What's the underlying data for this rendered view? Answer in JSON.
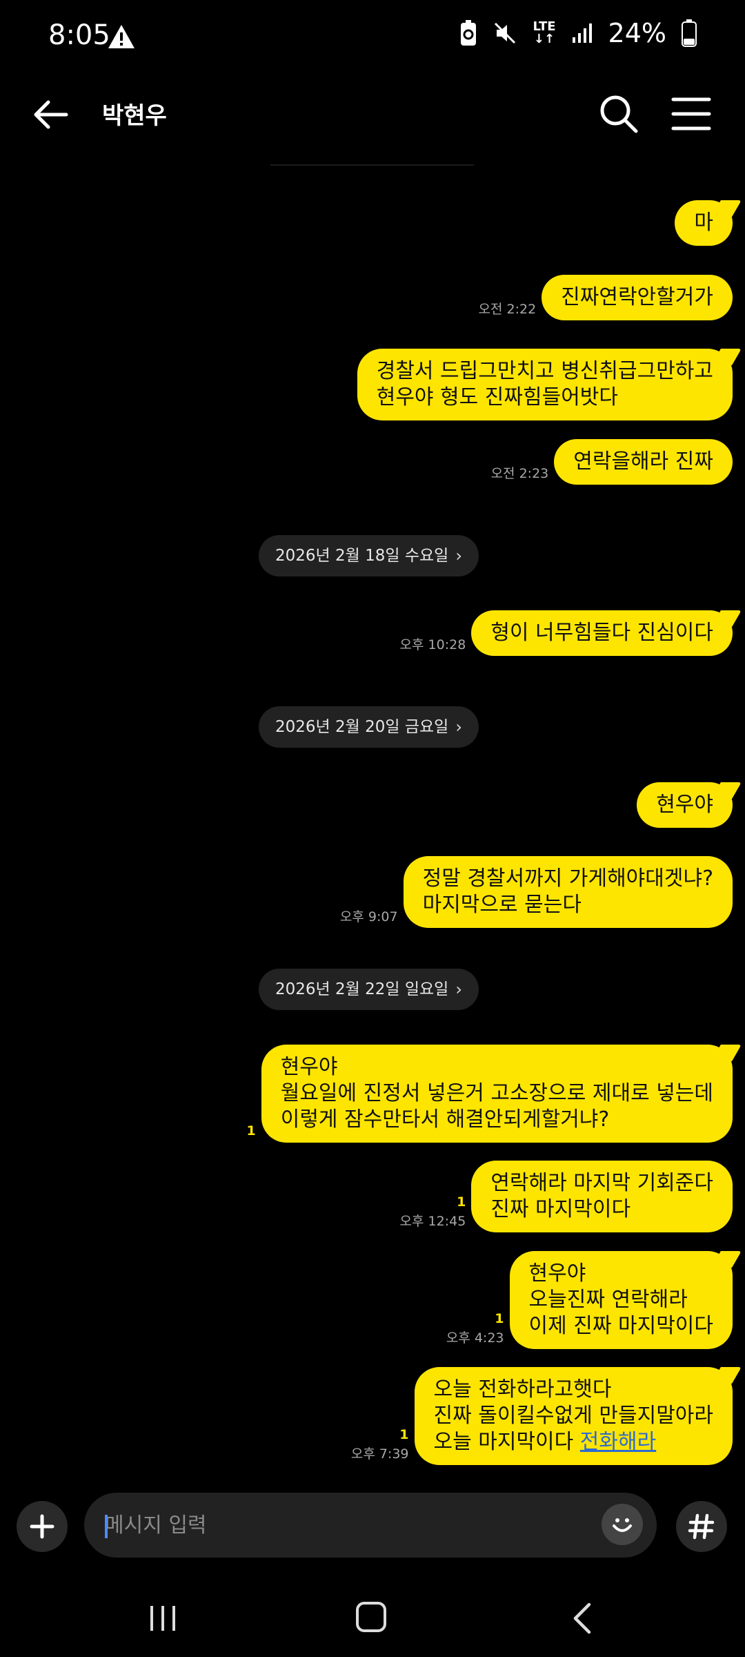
{
  "status_bar": {
    "time": "8:05",
    "network": "LTE",
    "battery": "24%"
  },
  "header": {
    "title": "박현우"
  },
  "date_pills": [
    {
      "label": "2026년 2월 18일 수요일"
    },
    {
      "label": "2026년 2월 20일 금요일"
    },
    {
      "label": "2026년 2월 22일 일요일"
    }
  ],
  "messages": [
    {
      "text": "마",
      "time": "",
      "unread": ""
    },
    {
      "text": "진짜연락안할거가",
      "time": "오전 2:22",
      "unread": ""
    },
    {
      "text": "경찰서 드립그만치고 병신취급그만하고\n현우야 형도 진짜힘들어밧다",
      "time": "",
      "unread": ""
    },
    {
      "text": "연락을해라 진짜",
      "time": "오전 2:23",
      "unread": ""
    },
    {
      "text": "형이 너무힘들다 진심이다",
      "time": "오후 10:28",
      "unread": ""
    },
    {
      "text": "현우야",
      "time": "",
      "unread": ""
    },
    {
      "text": "정말 경찰서까지 가게해야대겟냐?\n마지막으로 묻는다",
      "time": "오후 9:07",
      "unread": ""
    },
    {
      "text": "현우야\n월요일에 진정서 넣은거 고소장으로 제대로 넣는데\n이렇게 잠수만타서 해결안되게할거냐?",
      "time": "",
      "unread": "1"
    },
    {
      "text": "연락해라 마지막 기회준다\n진짜 마지막이다",
      "time": "오후 12:45",
      "unread": "1"
    },
    {
      "text": "현우야\n오늘진짜 연락해라\n이제 진짜 마지막이다",
      "time": "오후 4:23",
      "unread": "1"
    },
    {
      "text": "오늘 전화하라고햇다\n진짜 돌이킬수없게 만들지말아라\n오늘 마지막이다 ",
      "link": "전화해라",
      "time": "오후 7:39",
      "unread": "1"
    }
  ],
  "input": {
    "placeholder": "메시지 입력"
  },
  "icons": {
    "back": "arrow-left-icon",
    "search": "search-icon",
    "menu": "hamburger-menu-icon",
    "attach": "plus-icon",
    "emoji": "emoji-icon",
    "hash": "hash-icon"
  },
  "colors": {
    "bubble": "#fee500",
    "background": "#000000",
    "pill": "#222222",
    "link": "#2d6ad3"
  }
}
